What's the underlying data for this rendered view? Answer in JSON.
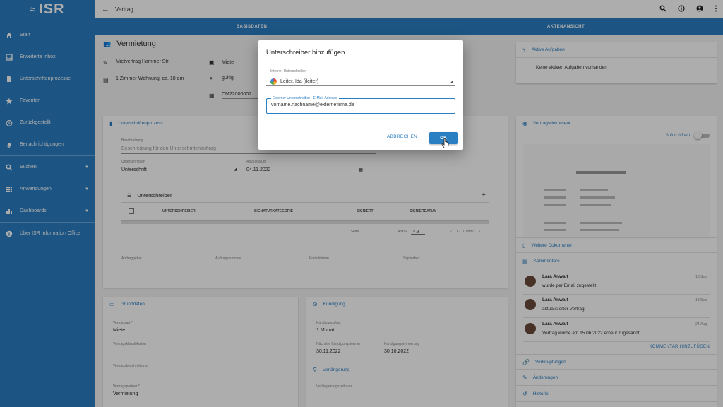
{
  "app": {
    "logo": "ISR"
  },
  "sidebar": {
    "items": [
      {
        "label": "Start",
        "icon": "home-icon"
      },
      {
        "label": "Erweiterte Inbox",
        "icon": "inbox-icon"
      },
      {
        "label": "Unterschriftenprozesse",
        "icon": "document-icon"
      },
      {
        "label": "Favoriten",
        "icon": "star-icon"
      },
      {
        "label": "Zurückgestellt",
        "icon": "clock-icon"
      },
      {
        "label": "Benachrichtigungen",
        "icon": "bell-icon"
      },
      {
        "label": "Suchen",
        "icon": "search-icon"
      },
      {
        "label": "Anwendungen",
        "icon": "apps-icon"
      },
      {
        "label": "Dashboards",
        "icon": "chart-icon"
      },
      {
        "label": "Über ISR Information Office",
        "icon": "info-icon"
      }
    ]
  },
  "topbar": {
    "title": "Vertrag"
  },
  "tabs": [
    "BASISDATEN",
    "AKTENANSICHT"
  ],
  "vermietung": {
    "title": "Vermietung",
    "name": "Mietvertrag Hammer Str.",
    "desc": "1 Zimmer-Wohnung, ca. 18 qm",
    "type": "Miete",
    "status": "gültig",
    "number": "CM22000007"
  },
  "aufgaben": {
    "title": "Aktive Aufgaben",
    "empty": "Keine aktiven Aufgaben vorhanden"
  },
  "up": {
    "title": "Unterschriftenprozess",
    "desc_label": "Beschreibung",
    "desc_placeholder": "Beschreibung für den Unterschriftenauftrag",
    "type_label": "Unterschriftsart",
    "type_value": "Unterschrift",
    "date_label": "Ablaufdatum",
    "date_value": "04.11.2022",
    "signers_title": "Unterschreiber",
    "cols": [
      "UNTERSCHREIBER",
      "SIGNATURKATEGORIE",
      "SIGNIERT",
      "SIGNIERDATUM"
    ],
    "pager_seite": "Seite",
    "pager_seite_value": "1",
    "pager_anzahl": "Anz/S",
    "pager_anzahl_value": "10",
    "pager_range": "1 - 10 von 0",
    "footer": [
      "Auftraggeber",
      "Auftragsnummer",
      "Erstelldatum",
      "Signierbox"
    ]
  },
  "grunddaten": {
    "title": "Grunddaten",
    "vertragsart_label": "Vertragsart *",
    "vertragsart_value": "Miete",
    "klass_label": "Vertragsklassifikation",
    "bes_label": "Vertragsbeschreibung",
    "partner_label": "Vertragspartner *",
    "partner_value": "Vermietung"
  },
  "kuendigung": {
    "title": "Kündigung",
    "frist_label": "Kündigungsfrist",
    "frist_value": "1 Monat",
    "next_label": "Nächster Kündigungstermin",
    "next_value": "30.11.2022",
    "reminder_label": "Kündigungserinnerung",
    "reminder_value": "30.10.2022",
    "verl_title": "Verlängerung",
    "verl_label": "Verlängerungszeitraum"
  },
  "vertragsdokument": {
    "title": "Vertragsdokument",
    "sofort": "Sofort öffnen",
    "more_docs": "Weitere Dokumente",
    "comments_title": "Kommentare",
    "comments": [
      {
        "author": "Lara Anwalt",
        "date": "13.Sep",
        "text": "wurde per Email zugestellt"
      },
      {
        "author": "Lara Anwalt",
        "date": "13.Sep",
        "text": "aktualisierter Vertrag"
      },
      {
        "author": "Lara Anwalt",
        "date": "24.Aug",
        "text": "Vertrag wurde am 15.06.2022 erneut zugesandt"
      }
    ],
    "add_comment": "KOMMENTAR HINZUFÜGEN",
    "links": [
      "Verknüpfungen",
      "Änderungen",
      "Historie"
    ]
  },
  "dialog": {
    "title": "Unterschreiber hinzufügen",
    "internal_label": "Interner Unterschreiber",
    "internal_value": "Leiter, Ida (ileiter)",
    "external_label": "Externer Unterschreiber - E-Mail-Adresse",
    "external_value": "vorname.nachname@externefirma.de",
    "cancel": "ABBRECHEN",
    "ok": "OK"
  },
  "colors": {
    "primary": "#2a7ec2",
    "overlay": "rgba(0,0,0,0.32)"
  }
}
